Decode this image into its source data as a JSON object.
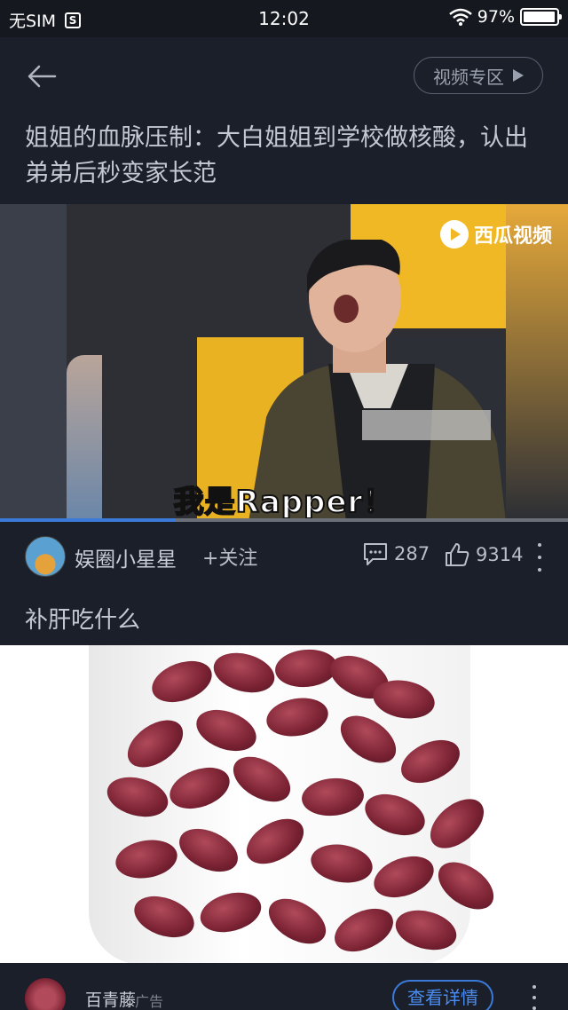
{
  "status_bar": {
    "carrier": "无SIM",
    "sim_icon_text": "S",
    "time": "12:02",
    "battery": "97%",
    "battery_level": 0.97
  },
  "nav": {
    "back_icon": "arrow-left-icon",
    "video_zone_label": "视频专区"
  },
  "article": {
    "title": "姐姐的血脉压制：大白姐姐到学校做核酸，认出弟弟后秒变家长范"
  },
  "video": {
    "watermark": "西瓜视频",
    "subtitle": "我是Rapper！",
    "progress": 0.31
  },
  "author": {
    "name": "娱圈小星星",
    "follow_label": "+关注",
    "comments": "287",
    "likes": "9314"
  },
  "ad": {
    "title": "补肝吃什么",
    "advertiser": "百青藤",
    "tag": "广告",
    "cta_label": "查看详情"
  },
  "colors": {
    "background": "#1b1f2a",
    "accent_blue": "#3b7ad9",
    "text": "#c9cdd6"
  }
}
